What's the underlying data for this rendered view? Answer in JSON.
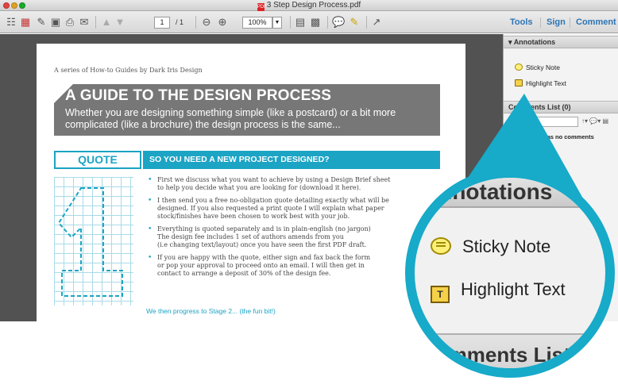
{
  "window": {
    "title": "3 Step Design Process.pdf"
  },
  "toolbar": {
    "page_current": "1",
    "page_total": "/ 1",
    "zoom": "100%",
    "links": [
      "Tools",
      "Sign",
      "Comment"
    ]
  },
  "document": {
    "series": "A series of How-to Guides by Dark Iris Design",
    "title": "A GUIDE TO THE DESIGN PROCESS",
    "subtitle": "Whether you are designing something simple (like a postcard) or a bit more complicated (like a brochure) the design process is the same...",
    "quote_label": "QUOTE",
    "section_heading": "SO YOU NEED A NEW PROJECT DESIGNED?",
    "bullets": [
      [
        "First we discuss what you want to achieve by using a Design Brief sheet",
        "to help you decide what you are looking for (download it here)."
      ],
      [
        "I then send you a free no-obligation quote detailing exactly what will be",
        "designed. If you also requested a print quote I will explain what paper",
        "stock/finishes have been chosen to work best with your job."
      ],
      [
        "Everything is quoted separately and is in plain-english (no jargon)",
        "The design fee includes 1 set of authors amends from you",
        "(i.e changing text/layout) once you have seen the first PDF draft."
      ],
      [
        "If you are happy with the quote, either sign and fax back the form",
        "or pop your approval to proceed onto an email. I will then get in",
        "contact to arrange a deposit of 30% of the design fee."
      ]
    ],
    "progress": "We then progress to Stage 2... (the fun bit!)"
  },
  "panel": {
    "annotations_header": "Annotations",
    "items": [
      "Sticky Note",
      "Highlight Text"
    ],
    "comments_header": "Comments List (0)",
    "comments_message": "ment has no comments"
  },
  "magnifier": {
    "header": "Annotations",
    "items": [
      "Sticky Note",
      "Highlight Text"
    ],
    "footer": "Comments List"
  },
  "colors": {
    "accent": "#1ba4c4",
    "banner": "#777777",
    "doc_bg": "#525252"
  }
}
